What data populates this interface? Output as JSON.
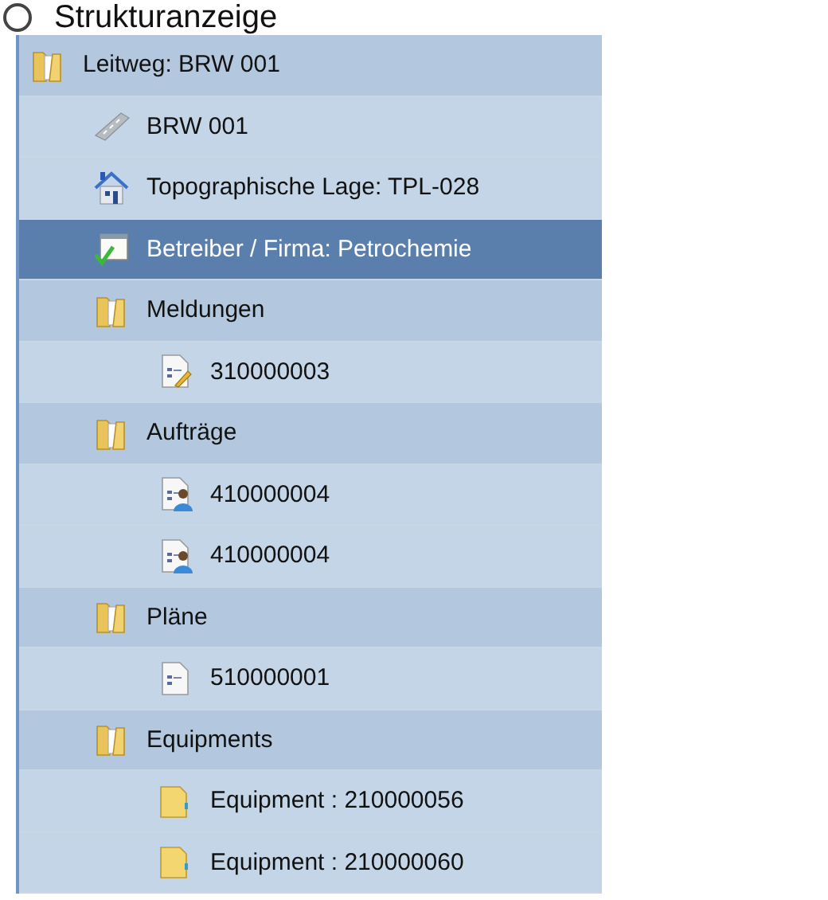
{
  "heading": {
    "title": "Strukturanzeige"
  },
  "tree": [
    {
      "label": "Leitweg: BRW 001",
      "kind": "folder",
      "selected": false,
      "children": [
        {
          "label": "BRW 001",
          "kind": "route",
          "selected": false
        },
        {
          "label": "Topographische Lage: TPL-028",
          "kind": "location",
          "selected": false
        },
        {
          "label": "Betreiber / Firma: Petrochemie",
          "kind": "operator",
          "selected": true
        },
        {
          "label": "Meldungen",
          "kind": "folder",
          "selected": false,
          "children": [
            {
              "label": "310000003",
              "kind": "notification",
              "selected": false
            }
          ]
        },
        {
          "label": "Aufträge",
          "kind": "folder",
          "selected": false,
          "children": [
            {
              "label": "410000004",
              "kind": "order",
              "selected": false
            },
            {
              "label": "410000004",
              "kind": "order",
              "selected": false
            }
          ]
        },
        {
          "label": "Pläne",
          "kind": "folder",
          "selected": false,
          "children": [
            {
              "label": "510000001",
              "kind": "plan",
              "selected": false
            }
          ]
        },
        {
          "label": "Equipments",
          "kind": "folder",
          "selected": false,
          "children": [
            {
              "label": "Equipment : 210000056",
              "kind": "equipment",
              "selected": false
            },
            {
              "label": "Equipment : 210000060",
              "kind": "equipment",
              "selected": false
            }
          ]
        }
      ]
    }
  ]
}
